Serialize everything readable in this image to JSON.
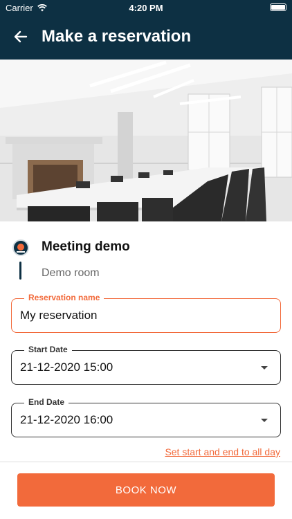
{
  "status_bar": {
    "carrier": "Carrier",
    "time": "4:20 PM"
  },
  "header": {
    "title": "Make a reservation"
  },
  "room": {
    "name": "Meeting demo",
    "subtitle": "Demo room"
  },
  "form": {
    "reservation_name": {
      "label": "Reservation name",
      "value": "My reservation"
    },
    "start_date": {
      "label": "Start Date",
      "value": "21-12-2020 15:00"
    },
    "end_date": {
      "label": "End Date",
      "value": "21-12-2020 16:00"
    },
    "all_day_link": "Set start and end to all day"
  },
  "actions": {
    "book_now": "BOOK NOW"
  },
  "colors": {
    "header_bg": "#0d3043",
    "accent": "#f26a3b"
  },
  "icons": [
    "wifi-icon",
    "battery-icon",
    "back-arrow-icon",
    "room-logo-icon",
    "dropdown-caret-icon"
  ]
}
